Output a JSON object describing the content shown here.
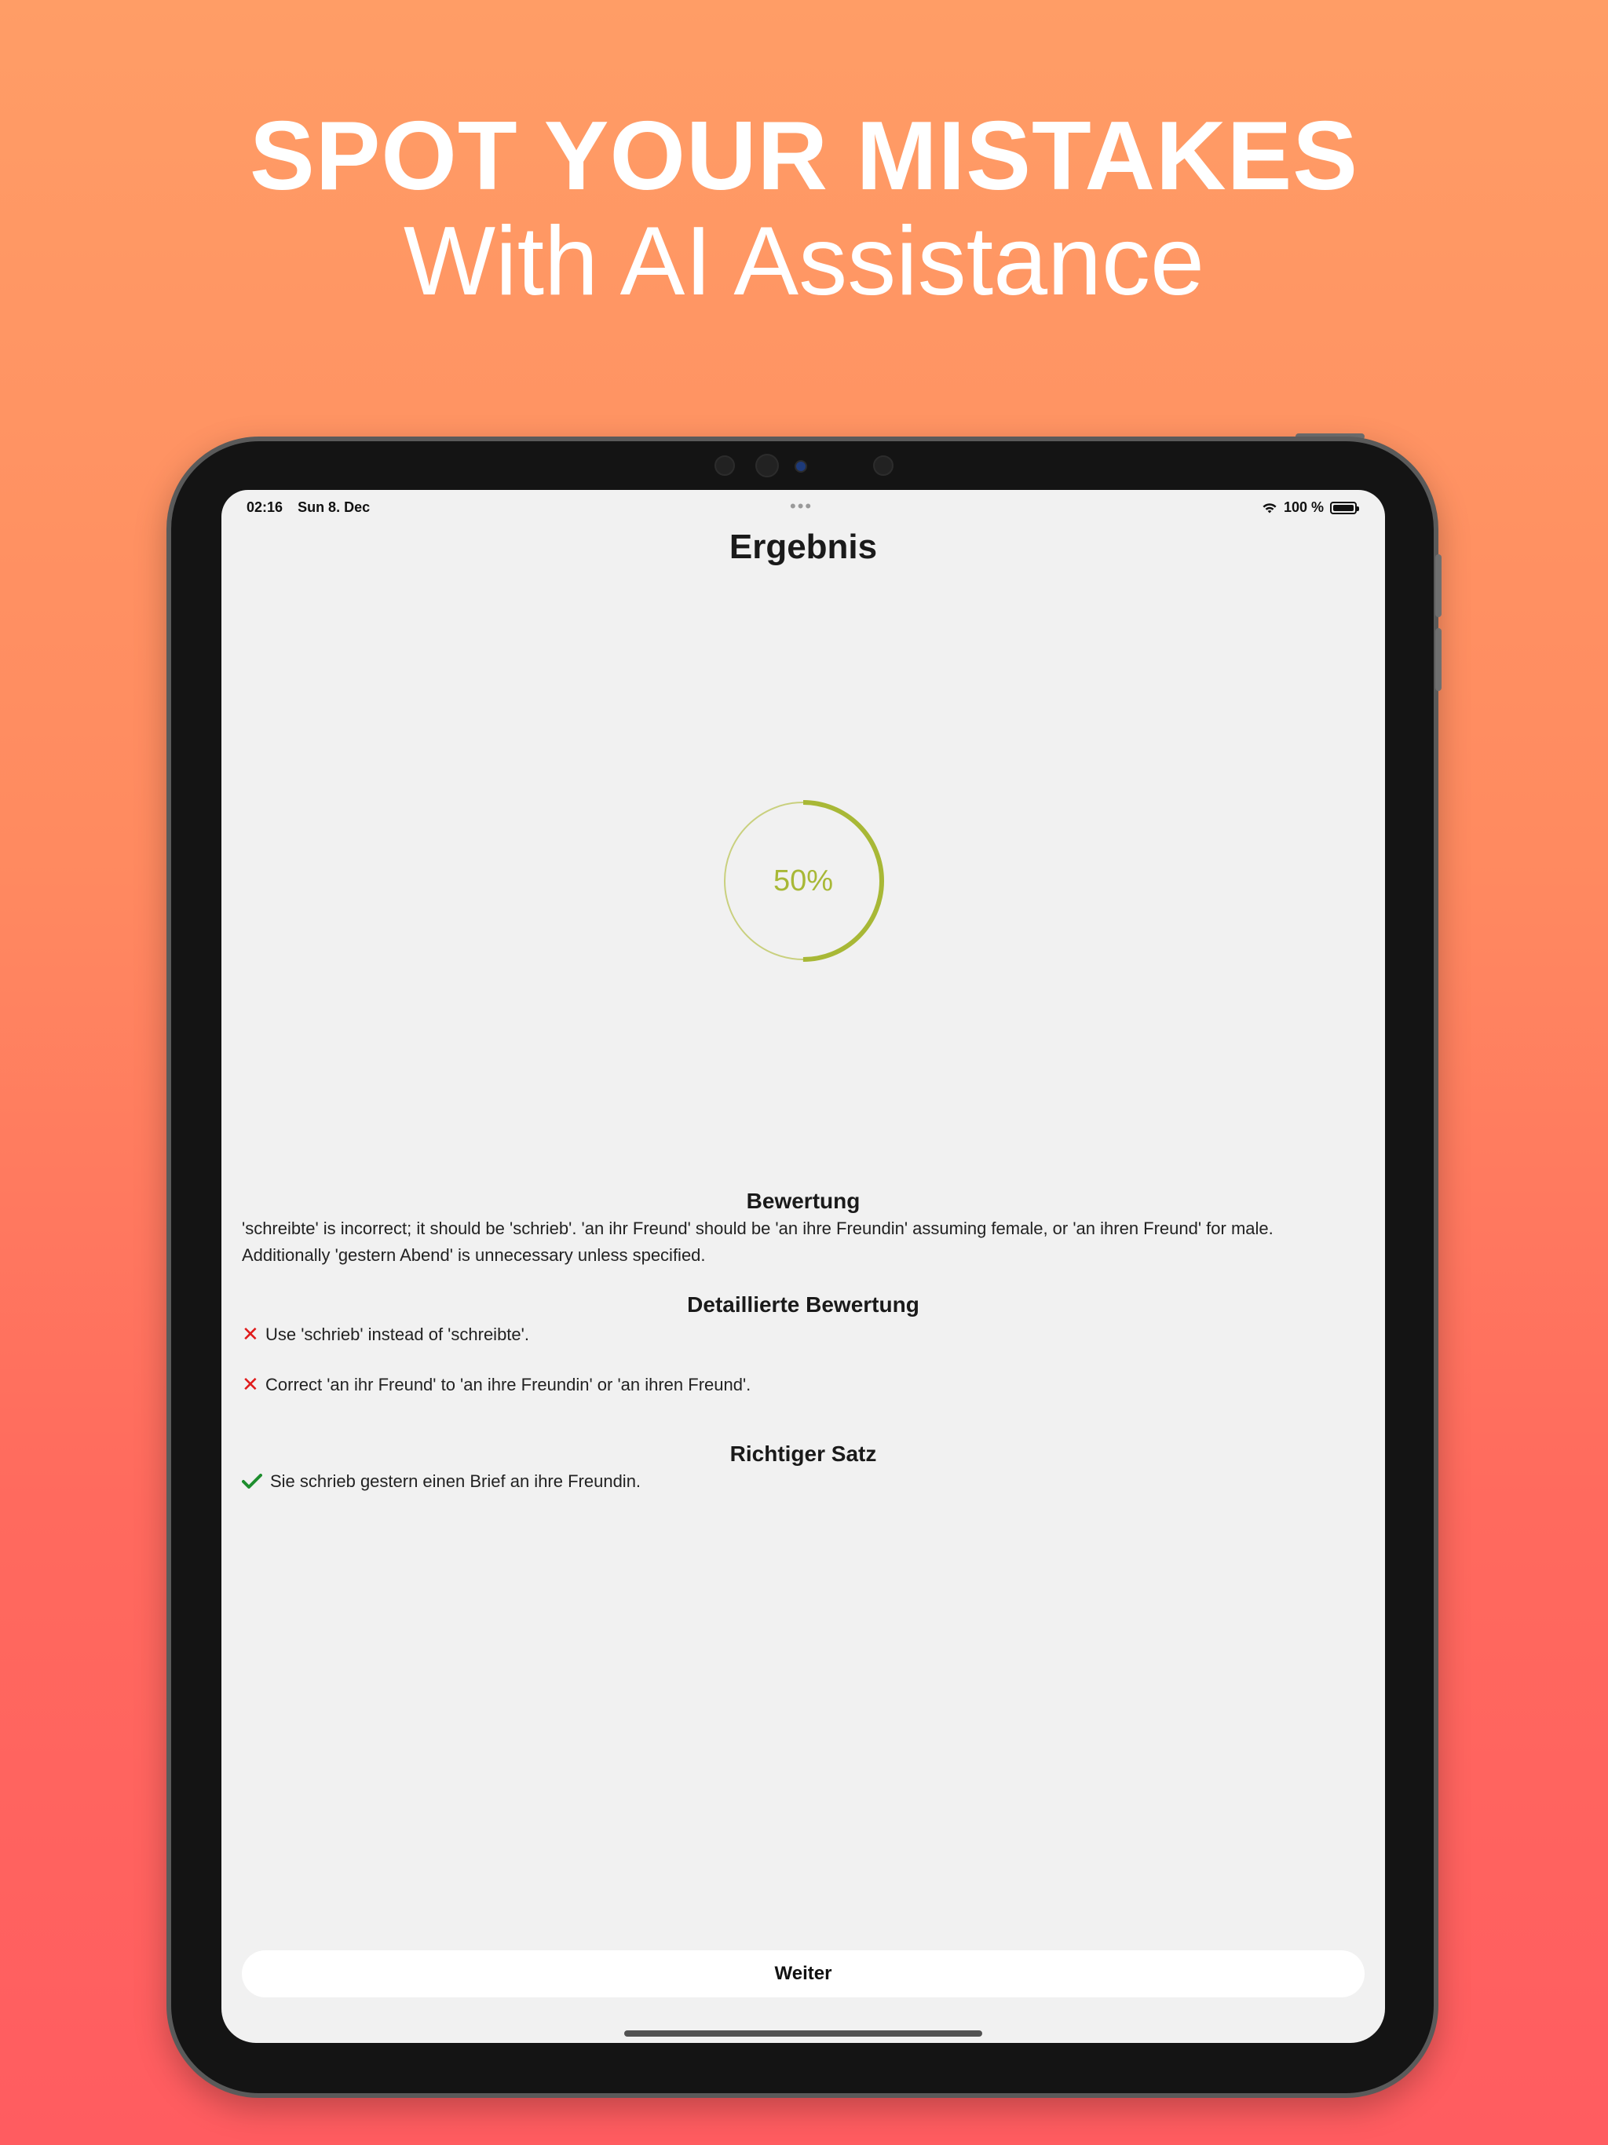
{
  "marketing": {
    "headline": "SPOT YOUR MISTAKES",
    "subheadline": "With AI Assistance"
  },
  "status_bar": {
    "time": "02:16",
    "date": "Sun 8. Dec",
    "dots": "•••",
    "battery": "100 %"
  },
  "screen": {
    "title": "Ergebnis",
    "score_label": "50%",
    "score_value": 0.5,
    "accent_color": "#A8B836"
  },
  "assessment": {
    "heading": "Bewertung",
    "text": "'schreibte' is incorrect; it should be 'schrieb'. 'an ihr Freund' should be 'an ihre Freundin' assuming female, or 'an ihren Freund' for male. Additionally 'gestern Abend' is unnecessary unless specified."
  },
  "detailed": {
    "heading": "Detaillierte Bewertung",
    "items": [
      {
        "icon": "x-icon",
        "text": "Use 'schrieb' instead of 'schreibte'."
      },
      {
        "icon": "x-icon",
        "text": "Correct 'an ihr Freund' to 'an ihre Freundin' or 'an ihren Freund'."
      }
    ]
  },
  "correct": {
    "heading": "Richtiger Satz",
    "icon": "checkmark-icon",
    "sentence": "Sie schrieb gestern einen Brief an ihre Freundin."
  },
  "footer": {
    "next_label": "Weiter"
  }
}
